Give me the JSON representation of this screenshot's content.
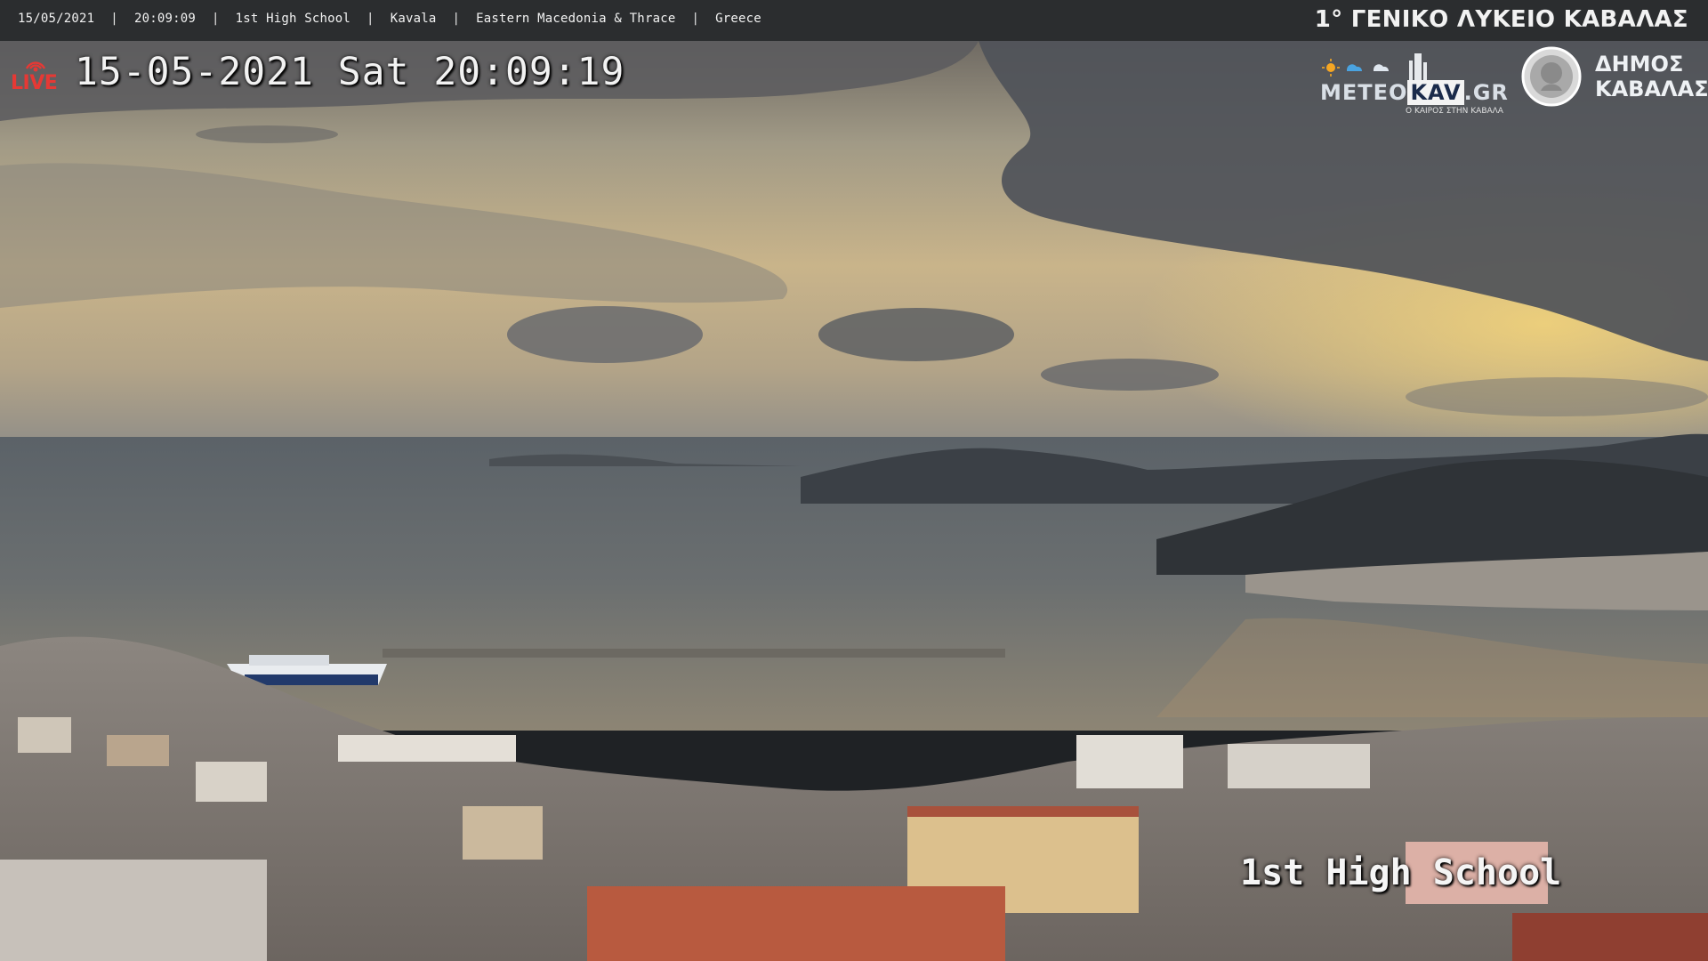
{
  "header": {
    "breadcrumbs": [
      "15/05/2021",
      "20:09:09",
      "1st High School",
      "Kavala",
      "Eastern Macedonia & Thrace",
      "Greece"
    ],
    "brand": "1° ΓΕΝΙΚΟ ΛΥΚΕΙΟ ΚΑΒΑΛΑΣ"
  },
  "overlay": {
    "live_label": "LIVE",
    "timestamp": "15-05-2021 Sat 20:09:19",
    "camera_label": "1st High School",
    "meteo_logo": {
      "prefix": "METEO",
      "highlight": "KAV",
      "suffix": ".GR",
      "tagline": "Ο ΚΑΙΡΟΣ ΣΤΗΝ ΚΑΒΑΛΑ"
    },
    "municipality_logo": {
      "line1": "ΔΗΜΟΣ",
      "line2": "ΚΑΒΑΛΑΣ"
    }
  },
  "colors": {
    "live_red": "#e53935",
    "topbar_bg": "#2b2d2f",
    "meteo_blue": "#1a2a4a"
  }
}
